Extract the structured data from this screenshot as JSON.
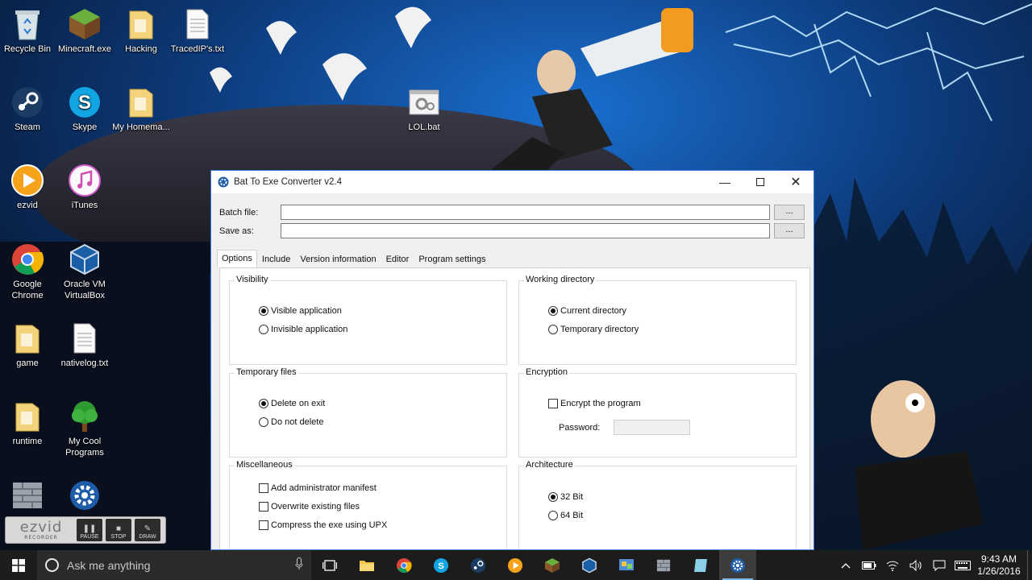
{
  "desktop": {
    "icons": [
      {
        "label": "Recycle Bin"
      },
      {
        "label": "Minecraft.exe"
      },
      {
        "label": "Hacking"
      },
      {
        "label": "TracedIP's.txt"
      },
      {
        "label": "Steam"
      },
      {
        "label": "Skype"
      },
      {
        "label": "My Homema..."
      },
      {
        "label": "LOL.bat"
      },
      {
        "label": "ezvid"
      },
      {
        "label": "iTunes"
      },
      {
        "label": "Google Chrome"
      },
      {
        "label": "Oracle VM VirtualBox"
      },
      {
        "label": "game"
      },
      {
        "label": "nativelog.txt"
      },
      {
        "label": "runtime"
      },
      {
        "label": "My Cool Programs"
      }
    ]
  },
  "ezvid": {
    "logo": "ezvid",
    "sublogo": "RECORDER",
    "pause": "PAUSE",
    "stop": "STOP",
    "draw": "DRAW"
  },
  "window": {
    "title": "Bat To Exe Converter v2.4",
    "batch_label": "Batch file:",
    "saveas_label": "Save as:",
    "batch_value": "",
    "saveas_value": "",
    "browse_label": "...",
    "tabs": [
      {
        "label": "Options"
      },
      {
        "label": "Include"
      },
      {
        "label": "Version information"
      },
      {
        "label": "Editor"
      },
      {
        "label": "Program settings"
      }
    ],
    "groups": {
      "visibility": {
        "title": "Visibility",
        "options": [
          {
            "label": "Visible application",
            "checked": true
          },
          {
            "label": "Invisible application",
            "checked": false
          }
        ]
      },
      "working_directory": {
        "title": "Working directory",
        "options": [
          {
            "label": "Current directory",
            "checked": true
          },
          {
            "label": "Temporary directory",
            "checked": false
          }
        ]
      },
      "temporary_files": {
        "title": "Temporary files",
        "options": [
          {
            "label": "Delete on exit",
            "checked": true
          },
          {
            "label": "Do not delete",
            "checked": false
          }
        ]
      },
      "encryption": {
        "title": "Encryption",
        "encrypt_label": "Encrypt the program",
        "encrypt_checked": false,
        "password_label": "Password:"
      },
      "miscellaneous": {
        "title": "Miscellaneous",
        "options": [
          {
            "label": "Add administrator manifest",
            "checked": false
          },
          {
            "label": "Overwrite existing files",
            "checked": false
          },
          {
            "label": "Compress the exe using UPX",
            "checked": false
          }
        ]
      },
      "architecture": {
        "title": "Architecture",
        "options": [
          {
            "label": "32 Bit",
            "checked": true
          },
          {
            "label": "64 Bit",
            "checked": false
          }
        ]
      }
    }
  },
  "taskbar": {
    "search_placeholder": "Ask me anything",
    "time": "9:43 AM",
    "date": "1/26/2016"
  },
  "colors": {
    "accent": "#3b78d8",
    "taskbar": "#1c1c1c",
    "wallpaper_sky": "#0d3a7a"
  }
}
